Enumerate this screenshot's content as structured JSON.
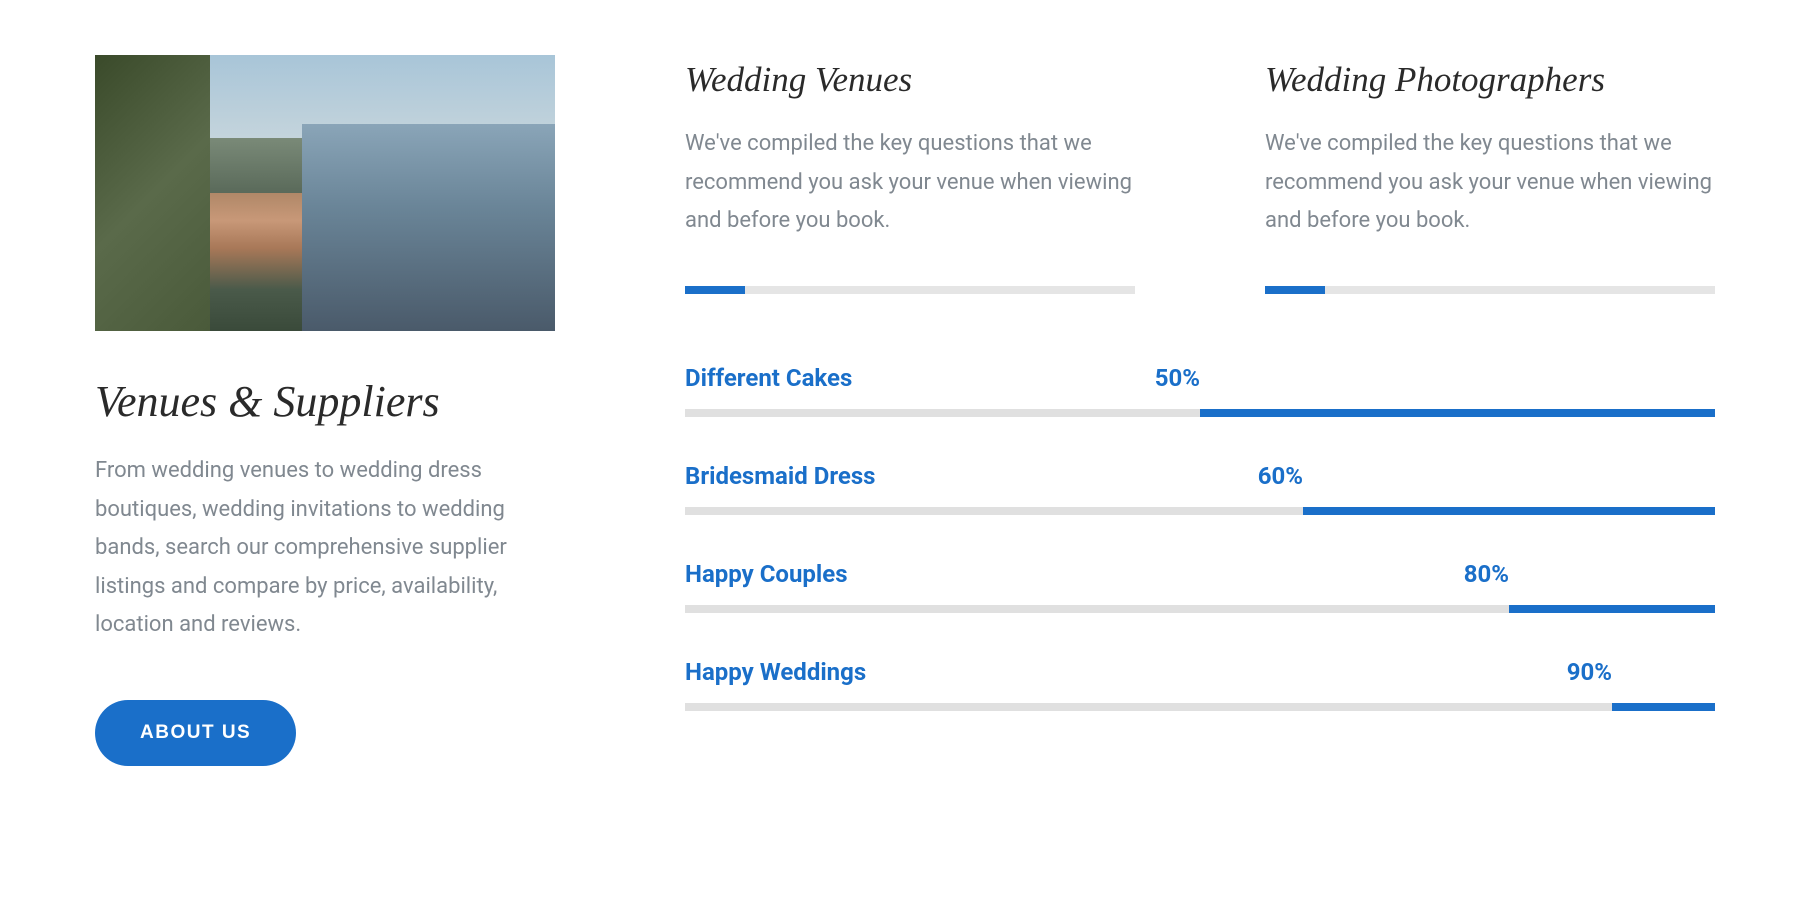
{
  "left": {
    "title": "Venues & Suppliers",
    "body": "From wedding venues to wedding dress boutiques, wedding invitations to wedding bands, search our comprehensive supplier listings and compare by price, availability, location and reviews.",
    "button": "ABOUT US"
  },
  "cards": [
    {
      "title": "Wedding Venues",
      "body": "We've compiled the key questions that we recommend you ask your venue when viewing and before you book."
    },
    {
      "title": "Wedding Photographers",
      "body": "We've compiled the key questions that we recommend you ask your venue when viewing and before you book."
    }
  ],
  "chart_data": {
    "type": "bar",
    "categories": [
      "Different Cakes",
      "Bridesmaid Dress",
      "Happy Couples",
      "Happy Weddings"
    ],
    "values": [
      50,
      60,
      80,
      90
    ],
    "value_suffix": "%",
    "xlim": [
      0,
      100
    ]
  }
}
